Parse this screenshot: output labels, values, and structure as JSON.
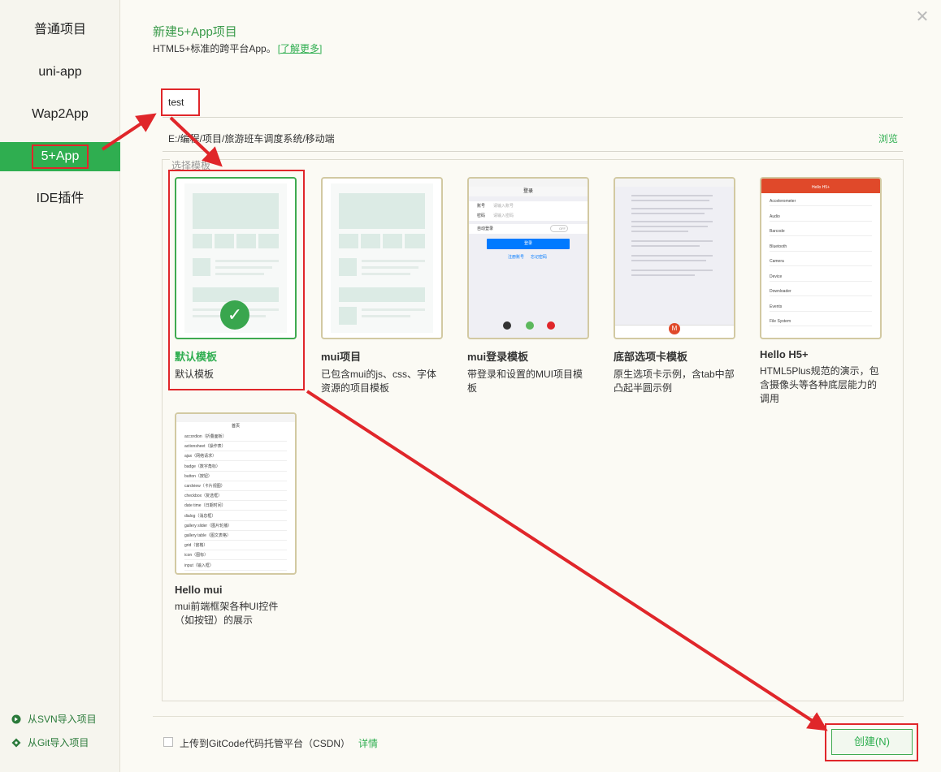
{
  "sidebar": {
    "items": [
      {
        "label": "普通项目"
      },
      {
        "label": "uni-app"
      },
      {
        "label": "Wap2App"
      },
      {
        "label": "5+App",
        "active": true
      },
      {
        "label": "IDE插件"
      }
    ],
    "svn_import": "从SVN导入项目",
    "git_import": "从Git导入项目"
  },
  "header": {
    "title": "新建5+App项目",
    "subtitle": "HTML5+标准的跨平台App。",
    "learn_more": "[了解更多]"
  },
  "form": {
    "project_name": "test",
    "path": "E:/编程/项目/旅游班车调度系统/移动端",
    "browse": "浏览",
    "template_section_label": "选择模板"
  },
  "templates": [
    {
      "title": "默认模板",
      "desc": "默认模板",
      "selected": true
    },
    {
      "title": "mui项目",
      "desc": "已包含mui的js、css、字体资源的项目模板"
    },
    {
      "title": "mui登录模板",
      "desc": "带登录和设置的MUI项目模板"
    },
    {
      "title": "底部选项卡模板",
      "desc": "原生选项卡示例，含tab中部凸起半圆示例"
    },
    {
      "title": "Hello H5+",
      "desc": "HTML5Plus规范的演示，包含摄像头等各种底层能力的调用"
    },
    {
      "title": "Hello mui",
      "desc": "mui前端框架各种UI控件（如按钮）的展示"
    }
  ],
  "thumb_text": {
    "login_title": "登录",
    "login_account": "账号",
    "login_password": "密码",
    "login_account_ph": "请输入账号",
    "login_password_ph": "请输入密码",
    "login_auto": "自动登录",
    "login_toggle": "OFF",
    "login_button": "登录",
    "login_register": "注册账号",
    "login_forgot": "忘记密码",
    "h5_header": "Hello H5+",
    "h5_items": [
      "Accelerometer",
      "Audio",
      "Barcode",
      "Bluetooth",
      "Camera",
      "Device",
      "Downloader",
      "Events",
      "File System"
    ],
    "mui_header": "首页",
    "mui_items": [
      "accordion（折叠面板）",
      "actionsheet（操作表）",
      "ajax（网络请求）",
      "badge（数字角标）",
      "button（按钮）",
      "cardview（卡片视图）",
      "checkbox（复选框）",
      "date time（日期时间）",
      "dialog（消息框）",
      "gallery slider（图片轮播）",
      "gallery table（图文表格）",
      "grid（宫格）",
      "icon（图标）",
      "input（输入框）"
    ],
    "tab_center": "M"
  },
  "footer": {
    "gitcode_label": "上传到GitCode代码托管平台（CSDN）",
    "gitcode_detail": "详情",
    "create_button": "创建(N)"
  },
  "colors": {
    "accent": "#2fae50",
    "annotation": "#e0262a",
    "card_border": "#d2c9a2"
  }
}
